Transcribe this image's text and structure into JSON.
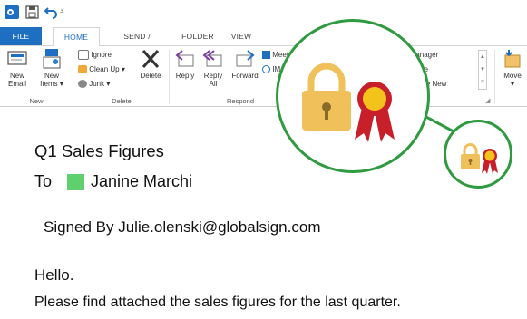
{
  "tabs": {
    "file": "FILE",
    "home": "HOME",
    "send_receive": "SEND / RECEIVE",
    "folder": "FOLDER",
    "view": "VIEW"
  },
  "ribbon": {
    "new_email_line1": "New",
    "new_email_line2": "Email",
    "new_items_line1": "New",
    "new_items_line2": "Items",
    "ignore": "Ignore",
    "clean_up": "Clean Up",
    "junk": "Junk",
    "delete": "Delete",
    "reply": "Reply",
    "reply_all_line1": "Reply",
    "reply_all_line2": "All",
    "forward": "Forward",
    "meeting": "Meet",
    "im": "IM",
    "to_manager": "To Manager",
    "done": "Done",
    "create_new": "reate New",
    "move": "Move",
    "group_new": "New",
    "group_delete": "Delete",
    "group_respond": "Respond"
  },
  "message": {
    "subject": "Q1 Sales Figures",
    "to_label": "To",
    "to_name": "Janine Marchi",
    "signed_by": "Signed By  Julie.olenski@globalsign.com",
    "greeting": "Hello.",
    "body": "Please find attached the sales figures for the last quarter."
  },
  "colors": {
    "accent": "#1e6fc1",
    "circle": "#2f9a3f",
    "lock": "#f0c05a",
    "ribbon_red": "#c8202a",
    "seal_gold": "#f3c21b",
    "contact_status": "#5fd06d"
  },
  "icons": [
    "outlook-icon",
    "save-icon",
    "undo-icon",
    "new-email-icon",
    "new-items-icon",
    "ignore-icon",
    "clean-up-icon",
    "junk-icon",
    "delete-icon",
    "reply-icon",
    "reply-all-icon",
    "forward-icon",
    "lock-icon",
    "certificate-ribbon-icon"
  ]
}
